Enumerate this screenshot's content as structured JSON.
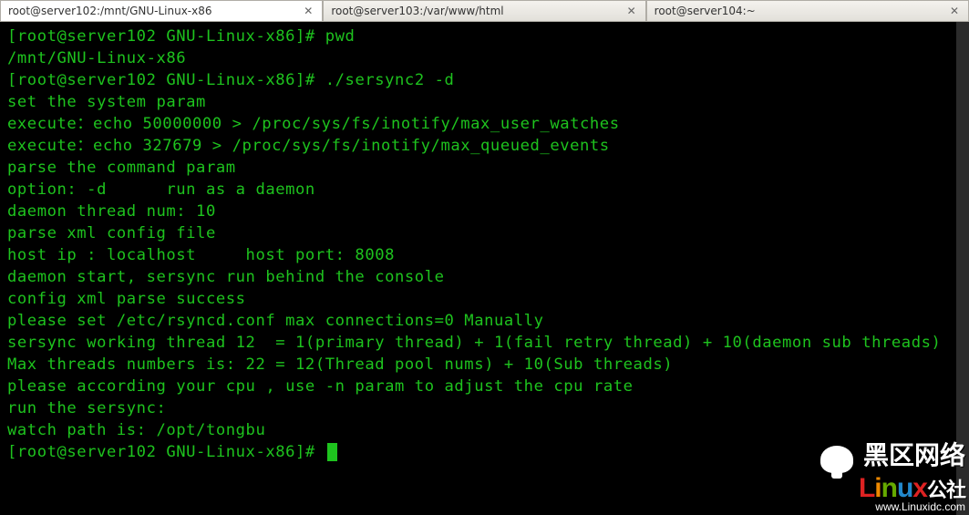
{
  "tabs": [
    {
      "label": "root@server102:/mnt/GNU-Linux-x86",
      "active": true
    },
    {
      "label": "root@server103:/var/www/html",
      "active": false
    },
    {
      "label": "root@server104:~",
      "active": false
    }
  ],
  "prompt": "[root@server102 GNU-Linux-x86]#",
  "session": {
    "cmd1": "pwd",
    "out1": "/mnt/GNU-Linux-x86",
    "cmd2": "./sersync2 -d",
    "lines": [
      "set the system param",
      "execute：echo 50000000 > /proc/sys/fs/inotify/max_user_watches",
      "execute：echo 327679 > /proc/sys/fs/inotify/max_queued_events",
      "parse the command param",
      "option: -d      run as a daemon",
      "daemon thread num: 10",
      "parse xml config file",
      "host ip : localhost     host port: 8008",
      "daemon start, sersync run behind the console",
      "config xml parse success",
      "please set /etc/rsyncd.conf max connections=0 Manually",
      "sersync working thread 12  = 1(primary thread) + 1(fail retry thread) + 10(daemon sub threads)",
      "Max threads numbers is: 22 = 12(Thread pool nums) + 10(Sub threads)",
      "please according your cpu , use -n param to adjust the cpu rate",
      "run the sersync:",
      "watch path is: /opt/tongbu"
    ]
  },
  "watermark": {
    "cn": "黑区网络",
    "brand_letters": [
      "L",
      "i",
      "n",
      "u",
      "x"
    ],
    "suffix": "公社",
    "url": "www.Linuxidc.com"
  },
  "colors": {
    "term_fg": "#1ec31e",
    "term_bg": "#000000",
    "tab_bg": "#e8e6e0"
  }
}
